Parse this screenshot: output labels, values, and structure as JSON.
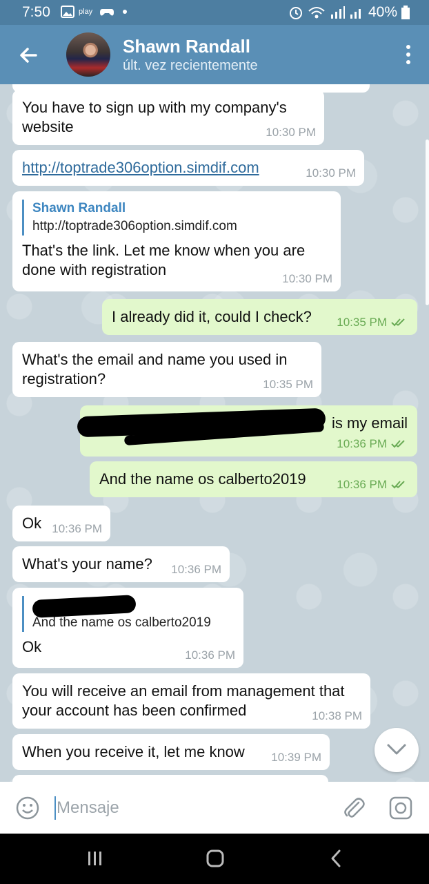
{
  "status_bar": {
    "time": "7:50",
    "battery": "40%"
  },
  "header": {
    "contact_name": "Shawn Randall",
    "contact_status": "últ. vez recientemente"
  },
  "messages": [
    {
      "text": "You have to sign up with my company's website",
      "time": "10:30 PM"
    },
    {
      "link": "http://toptrade306option.simdif.com",
      "time": "10:30 PM"
    },
    {
      "reply_name": "Shawn Randall",
      "reply_text": "http://toptrade306option.simdif.com",
      "text": "That's the link. Let me know when you are done with registration",
      "time": "10:30 PM"
    },
    {
      "text": "I already did it, could I check?",
      "time": "10:35 PM"
    },
    {
      "text": "What's the email and name you used in registration?",
      "time": "10:35 PM"
    },
    {
      "text": "is my email",
      "time": "10:36 PM"
    },
    {
      "text": "And the name os calberto2019",
      "time": "10:36 PM"
    },
    {
      "text": "Ok",
      "time": "10:36 PM"
    },
    {
      "text": "What's your name?",
      "time": "10:36 PM"
    },
    {
      "reply_text": "And the name os calberto2019",
      "text": "Ok",
      "time": "10:36 PM"
    },
    {
      "text": "You will receive an email from management that your account has been confirmed",
      "time": "10:38 PM"
    },
    {
      "text": "When you receive it, let me know",
      "time": "10:39 PM"
    }
  ],
  "input": {
    "placeholder": "Mensaje"
  },
  "colors": {
    "header": "#5a8fb6",
    "status_bar": "#4d7ea1",
    "outgoing_bubble": "#e2f8cc",
    "check": "#6aab55",
    "link": "#2e6a9b"
  }
}
